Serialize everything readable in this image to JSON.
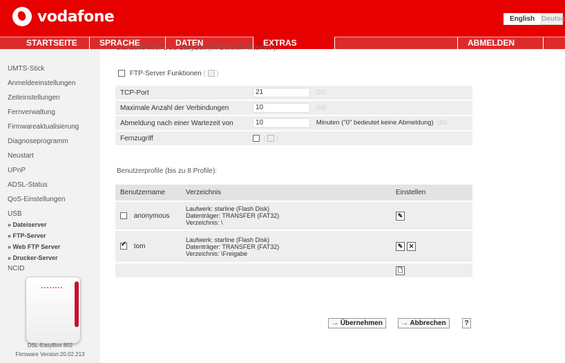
{
  "brand": {
    "name": "vodafone"
  },
  "languages": {
    "english": "English",
    "deutsch": "Deutsch"
  },
  "nav": [
    {
      "label": "STARTSEITE"
    },
    {
      "label": "SPRACHE"
    },
    {
      "label": "DATEN"
    },
    {
      "label": "EXTRAS"
    },
    {
      "label": ""
    },
    {
      "label": "ABMELDEN"
    },
    {
      "label": ""
    }
  ],
  "sidebar": {
    "items": [
      {
        "label": "UMTS-Stick"
      },
      {
        "label": "Anmeldeeinstellungen"
      },
      {
        "label": "Zeiteinstellungen"
      },
      {
        "label": "Fernverwaltung"
      },
      {
        "label": "Firmwareaktualisierung"
      },
      {
        "label": "Diagnoseprogramm"
      },
      {
        "label": "Neustart"
      },
      {
        "label": "UPnP"
      },
      {
        "label": "ADSL-Status"
      },
      {
        "label": "QoS-Einstellungen"
      },
      {
        "label": "USB"
      }
    ],
    "sub_items": [
      {
        "label": "» Dateiserver"
      },
      {
        "label": "» FTP-Server"
      },
      {
        "label": "» Web FTP Server"
      },
      {
        "label": "» Drucker-Server"
      }
    ],
    "after": {
      "label": "NCID"
    },
    "device_name": "DSL-EasyBox 802",
    "firmware": "Firmware Version:20.02.213"
  },
  "main": {
    "clipped_text": "Startseite Ihrer DSL-EasyBox (im Bereich \"Internet\").",
    "ftp_label": "FTP-Server Funktionen",
    "ftp_paren_open": "(",
    "ftp_paren_close": ")",
    "settings": [
      {
        "label": "TCP-Port",
        "value": "21",
        "hint": "(21)",
        "suffix": ""
      },
      {
        "label": "Maximale Anzahl der Verbindungen",
        "value": "10",
        "hint": "(10)",
        "suffix": ""
      },
      {
        "label": "Abmeldung nach einer Wartezeit von",
        "value": "10",
        "hint": "(10)",
        "suffix": "Minuten (\"0\" bedeutet keine Abmeldung)"
      }
    ],
    "remote_label": "Fernzugriff",
    "remote_paren_open": "(",
    "remote_paren_close": ")",
    "profiles_title": "Benutzerprofile (bis zu 8 Profile):",
    "columns": {
      "user": "Benutzername",
      "dir": "Verzeichnis",
      "config": "Einstellen"
    },
    "users": [
      {
        "name": "anonymous",
        "checked": false,
        "drive": "Laufwerk: starline (Flash Disk)",
        "volume": "Datenträger: TRANSFER (FAT32)",
        "folder": "Verzeichnis: \\"
      },
      {
        "name": "tom",
        "checked": true,
        "drive": "Laufwerk: starline (Flash Disk)",
        "volume": "Datenträger: TRANSFER (FAT32)",
        "folder": "Verzeichnis: \\Freigabe"
      }
    ],
    "buttons": {
      "apply": "Übernehmen",
      "cancel": "Abbrechen",
      "help": "?",
      "arrow": "→"
    },
    "icons": {
      "edit": "pencil-icon",
      "delete": "x-icon",
      "new": "document-icon"
    }
  },
  "colors": {
    "brand_red": "#e60000"
  }
}
